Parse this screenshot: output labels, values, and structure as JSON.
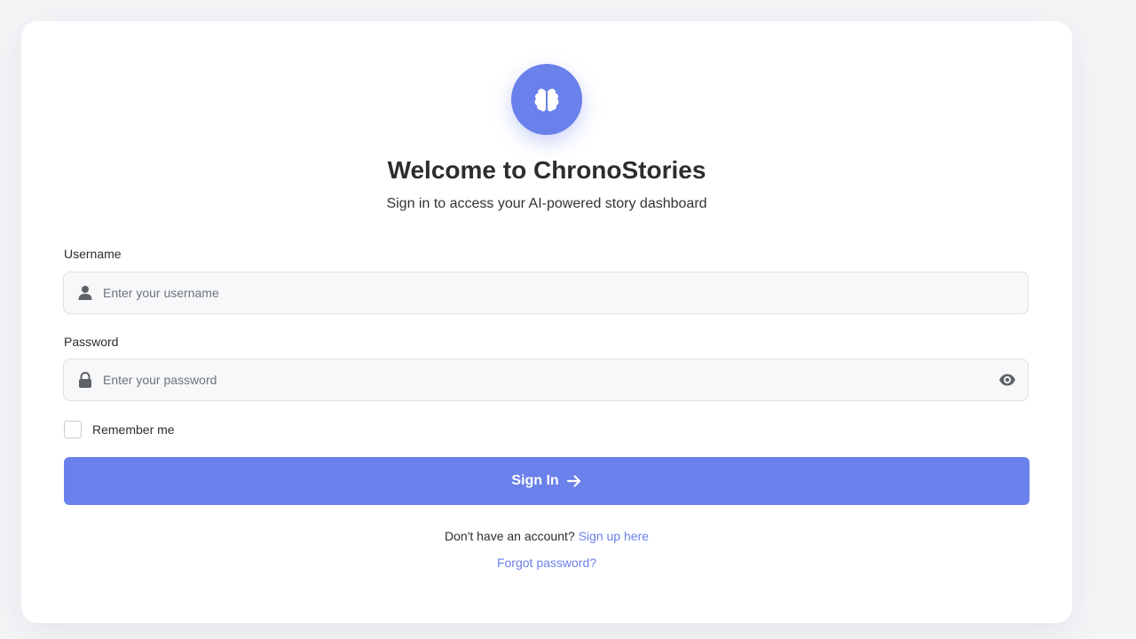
{
  "app": {
    "logo_icon": "brain-icon",
    "title": "Welcome to ChronoStories",
    "subtitle": "Sign in to access your AI-powered story dashboard"
  },
  "form": {
    "username": {
      "label": "Username",
      "placeholder": "Enter your username",
      "value": "",
      "icon": "user-icon"
    },
    "password": {
      "label": "Password",
      "placeholder": "Enter your password",
      "value": "",
      "icon": "lock-icon",
      "toggle_icon": "eye-icon"
    },
    "remember": {
      "label": "Remember me",
      "checked": false
    },
    "submit": {
      "label": "Sign In",
      "icon": "arrow-right-icon"
    }
  },
  "footer": {
    "signup_prompt": "Don't have an account?",
    "signup_link": "Sign up here",
    "forgot_link": "Forgot password?"
  },
  "colors": {
    "accent": "#6a80ea",
    "background": "#f4f5f7",
    "card": "#ffffff",
    "input_bg": "#f7f8fa"
  }
}
